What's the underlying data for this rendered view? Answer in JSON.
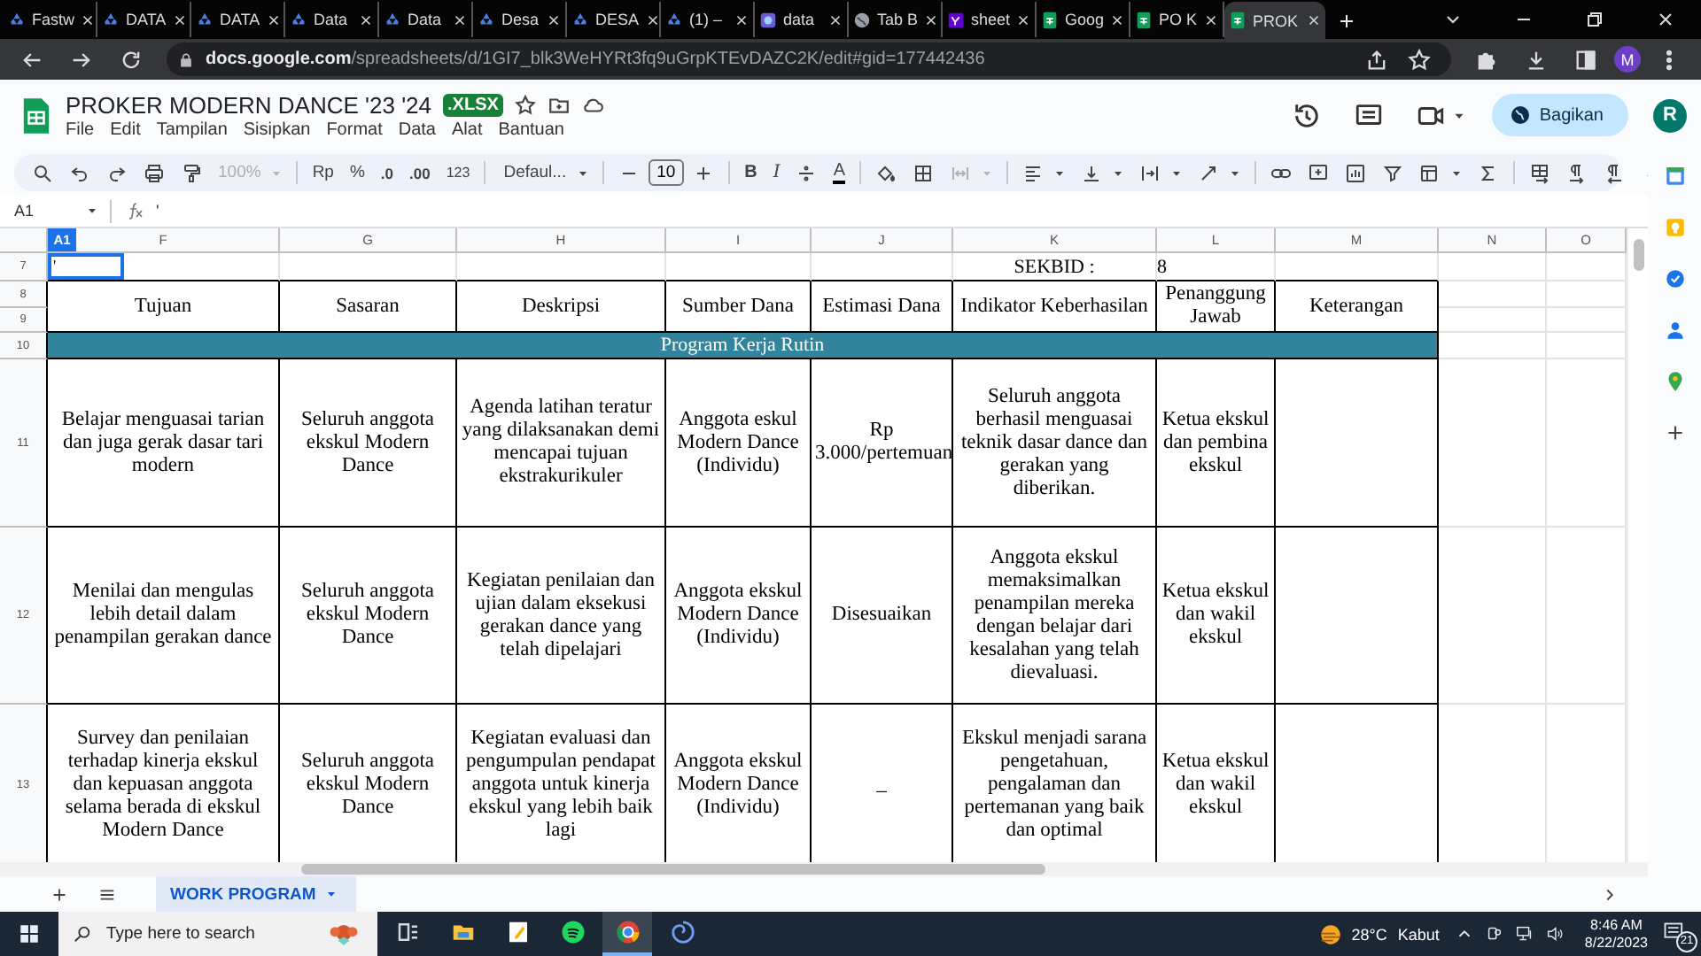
{
  "browser": {
    "tabs": [
      {
        "title": "Fastw",
        "kind": "drive",
        "selected": false
      },
      {
        "title": "DATA",
        "kind": "drive",
        "selected": false
      },
      {
        "title": "DATA",
        "kind": "drive",
        "selected": false
      },
      {
        "title": "Data",
        "kind": "drive",
        "selected": false
      },
      {
        "title": "Data",
        "kind": "drive",
        "selected": false
      },
      {
        "title": "Desa",
        "kind": "drive",
        "selected": false
      },
      {
        "title": "DESA",
        "kind": "drive",
        "selected": false
      },
      {
        "title": "(1) –",
        "kind": "drive",
        "selected": false
      },
      {
        "title": "data",
        "kind": "messenger",
        "selected": false
      },
      {
        "title": "Tab B",
        "kind": "globe",
        "selected": false
      },
      {
        "title": "sheet",
        "kind": "yahoo",
        "selected": false
      },
      {
        "title": "Goog",
        "kind": "sheets",
        "selected": false
      },
      {
        "title": "PO K",
        "kind": "sheets",
        "selected": false
      },
      {
        "title": "PROK",
        "kind": "sheets",
        "selected": true
      }
    ],
    "url_host": "docs.google.com",
    "url_path": "/spreadsheets/d/1GI7_blk3WeHYRt3fq9uGrpKTEvDAZC2K/edit#gid=177442436",
    "profile": "M"
  },
  "doc": {
    "title": "PROKER MODERN DANCE '23 '24",
    "badge": ".XLSX",
    "menus": [
      "File",
      "Edit",
      "Tampilan",
      "Sisipkan",
      "Format",
      "Data",
      "Alat",
      "Bantuan"
    ],
    "share_label": "Bagikan",
    "avatar": "R"
  },
  "toolbar": {
    "zoom": "100%",
    "zoom_disabled": true,
    "currency": "Rp",
    "percent": "%",
    "dec_less": ".0",
    "dec_more": ".00",
    "number_format": "123",
    "font": "Defaul...",
    "font_size": "10",
    "bold": "B",
    "italic": "I",
    "text_color": "A"
  },
  "formula_bar": {
    "name_box": "A1",
    "formula": "'"
  },
  "sheet": {
    "corner_badge": "A1",
    "columns": [
      "F",
      "G",
      "H",
      "I",
      "J",
      "K",
      "L",
      "M",
      "N",
      "O"
    ],
    "row_numbers": [
      "7",
      "8",
      "9",
      "10",
      "11",
      "12",
      "13"
    ],
    "selected_cell": "'",
    "sekbid_label": "SEKBID :",
    "sekbid_value": "8",
    "headers": [
      "Tujuan",
      "Sasaran",
      "Deskripsi",
      "Sumber  Dana",
      "Estimasi Dana",
      "Indikator Keberhasilan",
      "Penanggung Jawab",
      "Keterangan"
    ],
    "section_title": "Program Kerja Rutin",
    "rows": [
      {
        "cells": [
          "Belajar menguasai tarian dan juga gerak dasar tari modern",
          "Seluruh anggota ekskul Modern Dance",
          "Agenda latihan teratur yang dilaksanakan demi mencapai tujuan ekstrakurikuler",
          "Anggota eskul Modern Dance (Individu)",
          "Rp 3.000/pertemuan",
          "Seluruh anggota berhasil menguasai teknik dasar dance dan gerakan yang diberikan.",
          "Ketua ekskul dan pembina ekskul"
        ]
      },
      {
        "cells": [
          "Menilai dan mengulas lebih detail dalam penampilan gerakan dance",
          "Seluruh anggota ekskul Modern Dance",
          "Kegiatan penilaian dan ujian dalam eksekusi gerakan dance yang telah dipelajari",
          "Anggota ekskul Modern Dance (Individu)",
          "Disesuaikan",
          "Anggota ekskul memaksimalkan penampilan mereka dengan belajar dari kesalahan yang telah dievaluasi.",
          "Ketua ekskul dan wakil ekskul"
        ]
      },
      {
        "cells": [
          "Survey dan penilaian terhadap kinerja ekskul dan kepuasan anggota selama berada di ekskul Modern Dance",
          "Seluruh anggota ekskul Modern Dance",
          "Kegiatan evaluasi dan pengumpulan pendapat anggota untuk kinerja ekskul yang lebih baik lagi",
          "Anggota ekskul Modern Dance (Individu)",
          "_",
          "Ekskul menjadi sarana pengetahuan, pengalaman dan pertemanan yang baik dan optimal",
          "Ketua ekskul dan wakil ekskul"
        ]
      }
    ]
  },
  "sheet_tabs": [
    {
      "label": "WORK PROGRAM",
      "selected": true
    }
  ],
  "taskbar": {
    "search_placeholder": "Type here to search",
    "apps": [
      {
        "kind": "taskview",
        "active": false
      },
      {
        "kind": "files",
        "active": false
      },
      {
        "kind": "notes",
        "active": false
      },
      {
        "kind": "spotify",
        "active": false
      },
      {
        "kind": "chrome",
        "active": true
      },
      {
        "kind": "swirl",
        "active": false
      }
    ],
    "temperature": "28°C",
    "weather": "Kabut",
    "time": "8:46 AM",
    "date": "8/22/2023",
    "notifications": "21"
  }
}
